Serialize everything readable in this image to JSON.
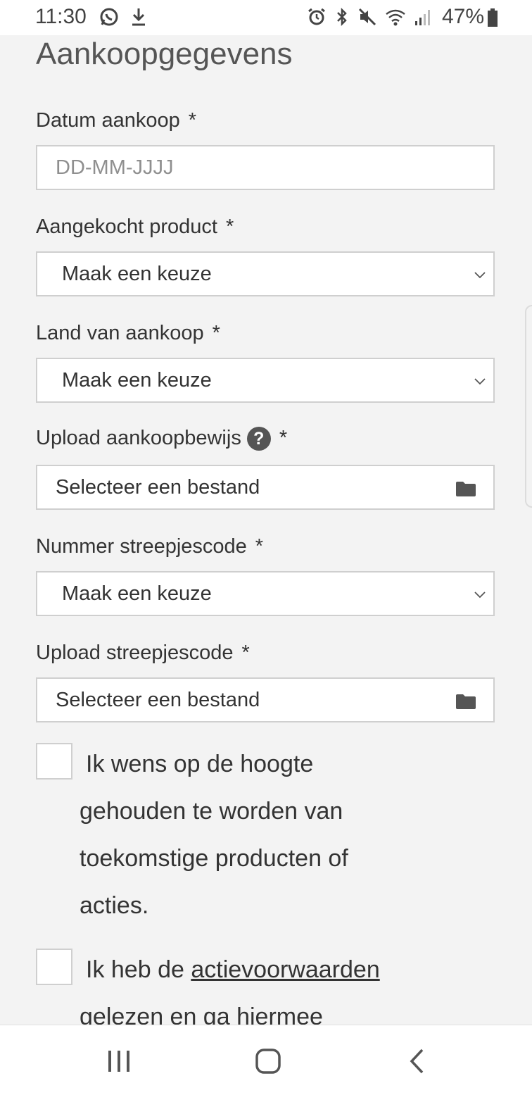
{
  "status_bar": {
    "time": "11:30",
    "battery": "47%",
    "icons_left": [
      "whatsapp-icon",
      "download-icon"
    ],
    "icons_right": [
      "alarm-icon",
      "bluetooth-icon",
      "mute-icon",
      "wifi-icon",
      "signal-icon",
      "battery-icon"
    ]
  },
  "form": {
    "title": "Aankoopgegevens",
    "required_marker": "*",
    "date": {
      "label": "Datum aankoop",
      "placeholder": "DD-MM-JJJJ"
    },
    "product": {
      "label": "Aangekocht product",
      "value": "Maak een keuze"
    },
    "country": {
      "label": "Land van aankoop",
      "value": "Maak een keuze"
    },
    "receipt": {
      "label": "Upload aankoopbewijs",
      "value": "Selecteer een bestand",
      "help": "?"
    },
    "barcode_number": {
      "label": "Nummer streepjescode",
      "value": "Maak een keuze"
    },
    "barcode_upload": {
      "label": "Upload streepjescode",
      "value": "Selecteer een bestand"
    },
    "newsletter": {
      "line1": "Ik wens op de hoogte",
      "line2": "gehouden te worden van",
      "line3": "toekomstige producten of",
      "line4": "acties."
    },
    "terms": {
      "prefix": "Ik heb de",
      "link": "actievoorwaarden",
      "line2": "gelezen en ga hiermee"
    }
  },
  "colors": {
    "background": "#f3f3f3",
    "field_border": "#cfcfcf",
    "text": "#333333"
  }
}
